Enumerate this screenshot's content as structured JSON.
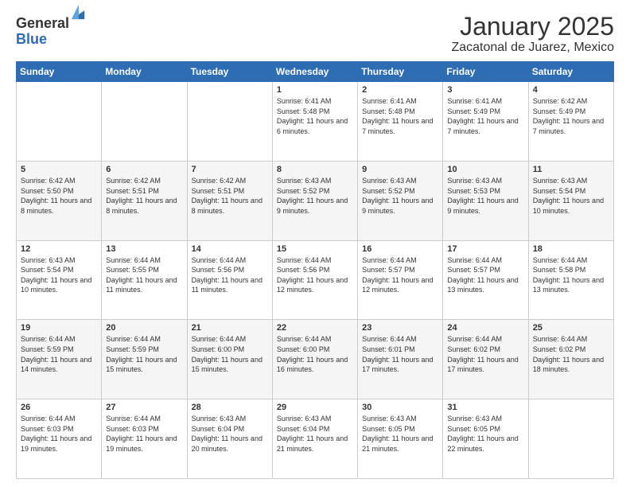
{
  "logo": {
    "general": "General",
    "blue": "Blue"
  },
  "header": {
    "month": "January 2025",
    "location": "Zacatonal de Juarez, Mexico"
  },
  "weekdays": [
    "Sunday",
    "Monday",
    "Tuesday",
    "Wednesday",
    "Thursday",
    "Friday",
    "Saturday"
  ],
  "weeks": [
    [
      {
        "day": "",
        "info": ""
      },
      {
        "day": "",
        "info": ""
      },
      {
        "day": "",
        "info": ""
      },
      {
        "day": "1",
        "info": "Sunrise: 6:41 AM\nSunset: 5:48 PM\nDaylight: 11 hours and 6 minutes."
      },
      {
        "day": "2",
        "info": "Sunrise: 6:41 AM\nSunset: 5:48 PM\nDaylight: 11 hours and 7 minutes."
      },
      {
        "day": "3",
        "info": "Sunrise: 6:41 AM\nSunset: 5:49 PM\nDaylight: 11 hours and 7 minutes."
      },
      {
        "day": "4",
        "info": "Sunrise: 6:42 AM\nSunset: 5:49 PM\nDaylight: 11 hours and 7 minutes."
      }
    ],
    [
      {
        "day": "5",
        "info": "Sunrise: 6:42 AM\nSunset: 5:50 PM\nDaylight: 11 hours and 8 minutes."
      },
      {
        "day": "6",
        "info": "Sunrise: 6:42 AM\nSunset: 5:51 PM\nDaylight: 11 hours and 8 minutes."
      },
      {
        "day": "7",
        "info": "Sunrise: 6:42 AM\nSunset: 5:51 PM\nDaylight: 11 hours and 8 minutes."
      },
      {
        "day": "8",
        "info": "Sunrise: 6:43 AM\nSunset: 5:52 PM\nDaylight: 11 hours and 9 minutes."
      },
      {
        "day": "9",
        "info": "Sunrise: 6:43 AM\nSunset: 5:52 PM\nDaylight: 11 hours and 9 minutes."
      },
      {
        "day": "10",
        "info": "Sunrise: 6:43 AM\nSunset: 5:53 PM\nDaylight: 11 hours and 9 minutes."
      },
      {
        "day": "11",
        "info": "Sunrise: 6:43 AM\nSunset: 5:54 PM\nDaylight: 11 hours and 10 minutes."
      }
    ],
    [
      {
        "day": "12",
        "info": "Sunrise: 6:43 AM\nSunset: 5:54 PM\nDaylight: 11 hours and 10 minutes."
      },
      {
        "day": "13",
        "info": "Sunrise: 6:44 AM\nSunset: 5:55 PM\nDaylight: 11 hours and 11 minutes."
      },
      {
        "day": "14",
        "info": "Sunrise: 6:44 AM\nSunset: 5:56 PM\nDaylight: 11 hours and 11 minutes."
      },
      {
        "day": "15",
        "info": "Sunrise: 6:44 AM\nSunset: 5:56 PM\nDaylight: 11 hours and 12 minutes."
      },
      {
        "day": "16",
        "info": "Sunrise: 6:44 AM\nSunset: 5:57 PM\nDaylight: 11 hours and 12 minutes."
      },
      {
        "day": "17",
        "info": "Sunrise: 6:44 AM\nSunset: 5:57 PM\nDaylight: 11 hours and 13 minutes."
      },
      {
        "day": "18",
        "info": "Sunrise: 6:44 AM\nSunset: 5:58 PM\nDaylight: 11 hours and 13 minutes."
      }
    ],
    [
      {
        "day": "19",
        "info": "Sunrise: 6:44 AM\nSunset: 5:59 PM\nDaylight: 11 hours and 14 minutes."
      },
      {
        "day": "20",
        "info": "Sunrise: 6:44 AM\nSunset: 5:59 PM\nDaylight: 11 hours and 15 minutes."
      },
      {
        "day": "21",
        "info": "Sunrise: 6:44 AM\nSunset: 6:00 PM\nDaylight: 11 hours and 15 minutes."
      },
      {
        "day": "22",
        "info": "Sunrise: 6:44 AM\nSunset: 6:00 PM\nDaylight: 11 hours and 16 minutes."
      },
      {
        "day": "23",
        "info": "Sunrise: 6:44 AM\nSunset: 6:01 PM\nDaylight: 11 hours and 17 minutes."
      },
      {
        "day": "24",
        "info": "Sunrise: 6:44 AM\nSunset: 6:02 PM\nDaylight: 11 hours and 17 minutes."
      },
      {
        "day": "25",
        "info": "Sunrise: 6:44 AM\nSunset: 6:02 PM\nDaylight: 11 hours and 18 minutes."
      }
    ],
    [
      {
        "day": "26",
        "info": "Sunrise: 6:44 AM\nSunset: 6:03 PM\nDaylight: 11 hours and 19 minutes."
      },
      {
        "day": "27",
        "info": "Sunrise: 6:44 AM\nSunset: 6:03 PM\nDaylight: 11 hours and 19 minutes."
      },
      {
        "day": "28",
        "info": "Sunrise: 6:43 AM\nSunset: 6:04 PM\nDaylight: 11 hours and 20 minutes."
      },
      {
        "day": "29",
        "info": "Sunrise: 6:43 AM\nSunset: 6:04 PM\nDaylight: 11 hours and 21 minutes."
      },
      {
        "day": "30",
        "info": "Sunrise: 6:43 AM\nSunset: 6:05 PM\nDaylight: 11 hours and 21 minutes."
      },
      {
        "day": "31",
        "info": "Sunrise: 6:43 AM\nSunset: 6:05 PM\nDaylight: 11 hours and 22 minutes."
      },
      {
        "day": "",
        "info": ""
      }
    ]
  ]
}
